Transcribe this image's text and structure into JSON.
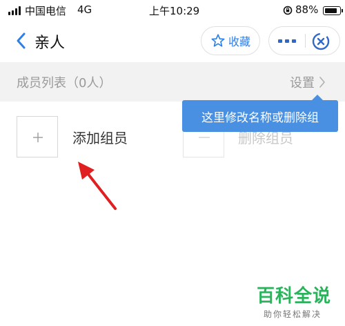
{
  "status_bar": {
    "carrier": "中国电信",
    "network": "4G",
    "time": "上午10:29",
    "battery_pct": "88%",
    "battery_level": 0.88,
    "signal_bars": 4
  },
  "nav": {
    "title": "亲人",
    "favorite_label": "收藏"
  },
  "section": {
    "title": "成员列表（0人）",
    "settings_label": "设置"
  },
  "members": {
    "add_label": "添加组员",
    "remove_label": "删除组员"
  },
  "tooltip": {
    "text": "这里修改名称或删除组"
  },
  "watermark": {
    "title": "百科全说",
    "subtitle": "助你轻松解决"
  },
  "colors": {
    "accent": "#2f7fe8",
    "tooltip_bg": "#4a90e2",
    "section_bg": "#f2f2f2",
    "annotation_arrow": "#e02020",
    "watermark_green": "#2ab35b"
  },
  "icons": {
    "back": "chevron-left-icon",
    "favorite": "star-icon",
    "more": "more-dots-icon",
    "close": "close-circle-icon",
    "settings_chevron": "chevron-right-icon",
    "add": "plus-icon",
    "remove": "minus-icon",
    "annotation": "red-arrow-icon"
  }
}
